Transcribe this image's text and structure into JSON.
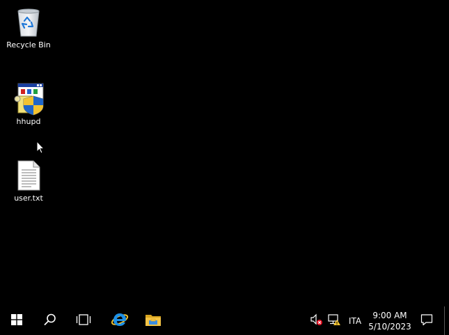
{
  "desktop": {
    "icons": [
      {
        "label": "Recycle Bin",
        "icon": "recycle-bin-icon"
      },
      {
        "label": "hhupd",
        "icon": "installer-shield-icon"
      },
      {
        "label": "user.txt",
        "icon": "text-file-icon"
      }
    ]
  },
  "taskbar": {
    "pinned": [
      {
        "icon": "windows-start-icon"
      },
      {
        "icon": "search-icon"
      },
      {
        "icon": "task-view-icon"
      },
      {
        "icon": "internet-explorer-icon"
      },
      {
        "icon": "file-explorer-icon"
      }
    ],
    "tray": {
      "language": "ITA",
      "time": "9:00 AM",
      "date": "5/10/2023"
    }
  },
  "colors": {
    "background": "#000000",
    "text": "#ffffff",
    "ie_blue": "#1e90e6",
    "folder_yellow": "#f5c445",
    "error_red": "#e81123"
  }
}
